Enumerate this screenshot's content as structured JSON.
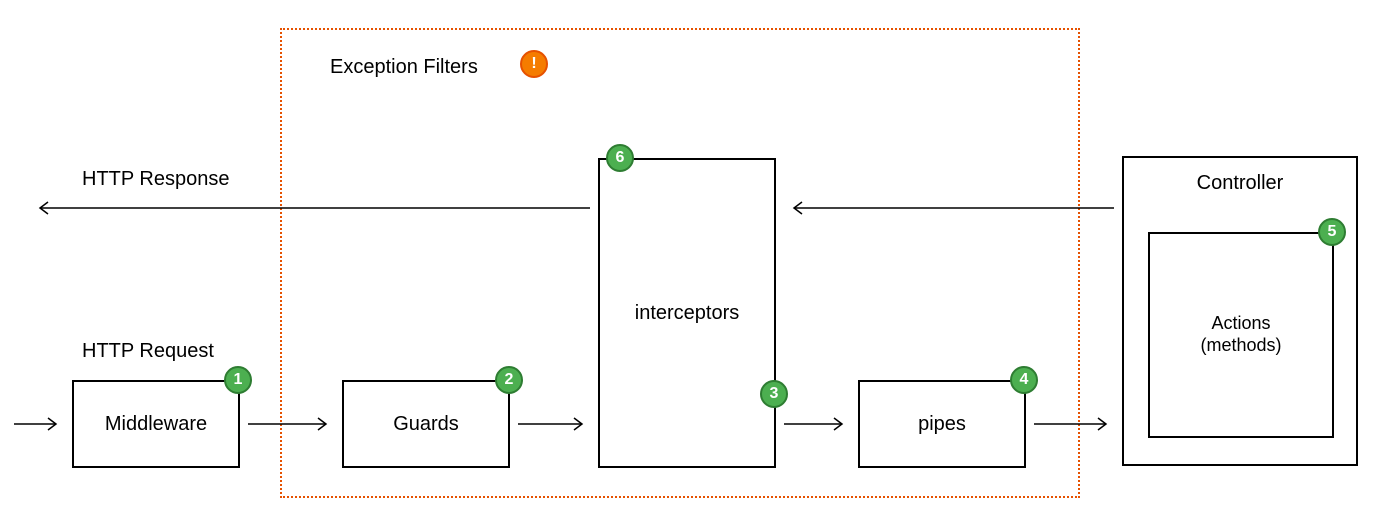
{
  "labels": {
    "http_request": "HTTP Request",
    "http_response": "HTTP Response",
    "exception_filters": "Exception Filters"
  },
  "boxes": {
    "middleware": "Middleware",
    "guards": "Guards",
    "interceptors": "interceptors",
    "pipes": "pipes",
    "controller": "Controller",
    "actions_line1": "Actions",
    "actions_line2": "(methods)"
  },
  "badges": {
    "b1": "1",
    "b2": "2",
    "b3": "3",
    "b4": "4",
    "b5": "5",
    "b6": "6",
    "warn": "!"
  },
  "chart_data": {
    "type": "flow-diagram",
    "title": "NestJS / HTTP request lifecycle",
    "nodes": [
      {
        "id": "middleware",
        "label": "Middleware",
        "order": 1
      },
      {
        "id": "guards",
        "label": "Guards",
        "order": 2
      },
      {
        "id": "interceptors",
        "label": "interceptors",
        "order_in": 3,
        "order_out": 6
      },
      {
        "id": "pipes",
        "label": "pipes",
        "order": 4
      },
      {
        "id": "controller",
        "label": "Controller"
      },
      {
        "id": "actions",
        "label": "Actions (methods)",
        "order": 5,
        "parent": "controller"
      }
    ],
    "edges_request": [
      [
        "(incoming)",
        "middleware"
      ],
      [
        "middleware",
        "guards"
      ],
      [
        "guards",
        "interceptors"
      ],
      [
        "interceptors",
        "pipes"
      ],
      [
        "pipes",
        "controller"
      ]
    ],
    "edges_response": [
      [
        "controller",
        "interceptors"
      ],
      [
        "interceptors",
        "(outgoing)"
      ]
    ],
    "region": {
      "label": "Exception Filters",
      "contains": [
        "guards",
        "interceptors",
        "pipes"
      ]
    },
    "annotations": [
      {
        "text": "HTTP Request",
        "attached_to": "request-flow"
      },
      {
        "text": "HTTP Response",
        "attached_to": "response-flow"
      }
    ]
  }
}
